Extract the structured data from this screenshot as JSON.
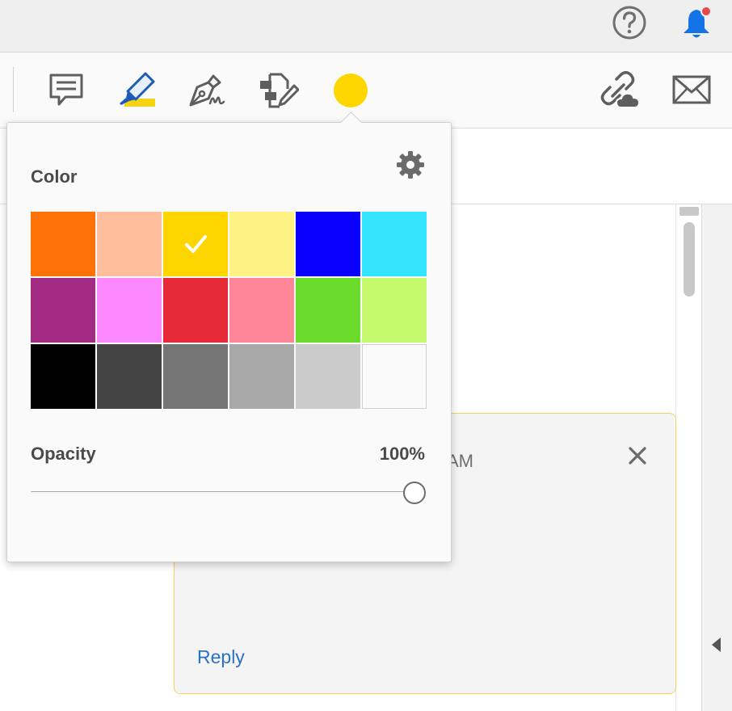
{
  "topbar": {
    "help_icon": "help-circle-icon",
    "notifications_icon": "bell-icon",
    "notification_dot_color": "#e5484d"
  },
  "toolbar": {
    "tools": [
      {
        "name": "comment-tool",
        "icon": "speech-bubble-icon"
      },
      {
        "name": "highlight-tool",
        "icon": "highlighter-icon"
      },
      {
        "name": "sign-tool",
        "icon": "pen-nib-signature-icon"
      },
      {
        "name": "edit-text-tool",
        "icon": "edit-document-icon"
      },
      {
        "name": "color-tool",
        "icon": "color-dot-icon",
        "current_color": "#FFD500"
      }
    ],
    "share_link_icon": "link-cloud-icon",
    "email_icon": "envelope-icon"
  },
  "color_popover": {
    "color_label": "Color",
    "settings_icon": "gear-icon",
    "selected_color": "#FFD500",
    "swatches": [
      "#FF7306",
      "#FFBF9F",
      "#FFD500",
      "#FEF284",
      "#0A00FF",
      "#35E4FF",
      "#A22C84",
      "#FC89FF",
      "#E62A38",
      "#FE8699",
      "#6BDB2C",
      "#C7F96E",
      "#000000",
      "#444444",
      "#757575",
      "#A8A8A8",
      "#CBCBCB",
      "#FAFAFA"
    ],
    "opacity_label": "Opacity",
    "opacity_value": "100%",
    "opacity_fraction": 1.0
  },
  "comment": {
    "time_fragment": "AM",
    "close_icon": "close-icon",
    "reply_label": "Reply"
  },
  "side_panel": {
    "collapse_icon": "chevron-left-icon"
  }
}
